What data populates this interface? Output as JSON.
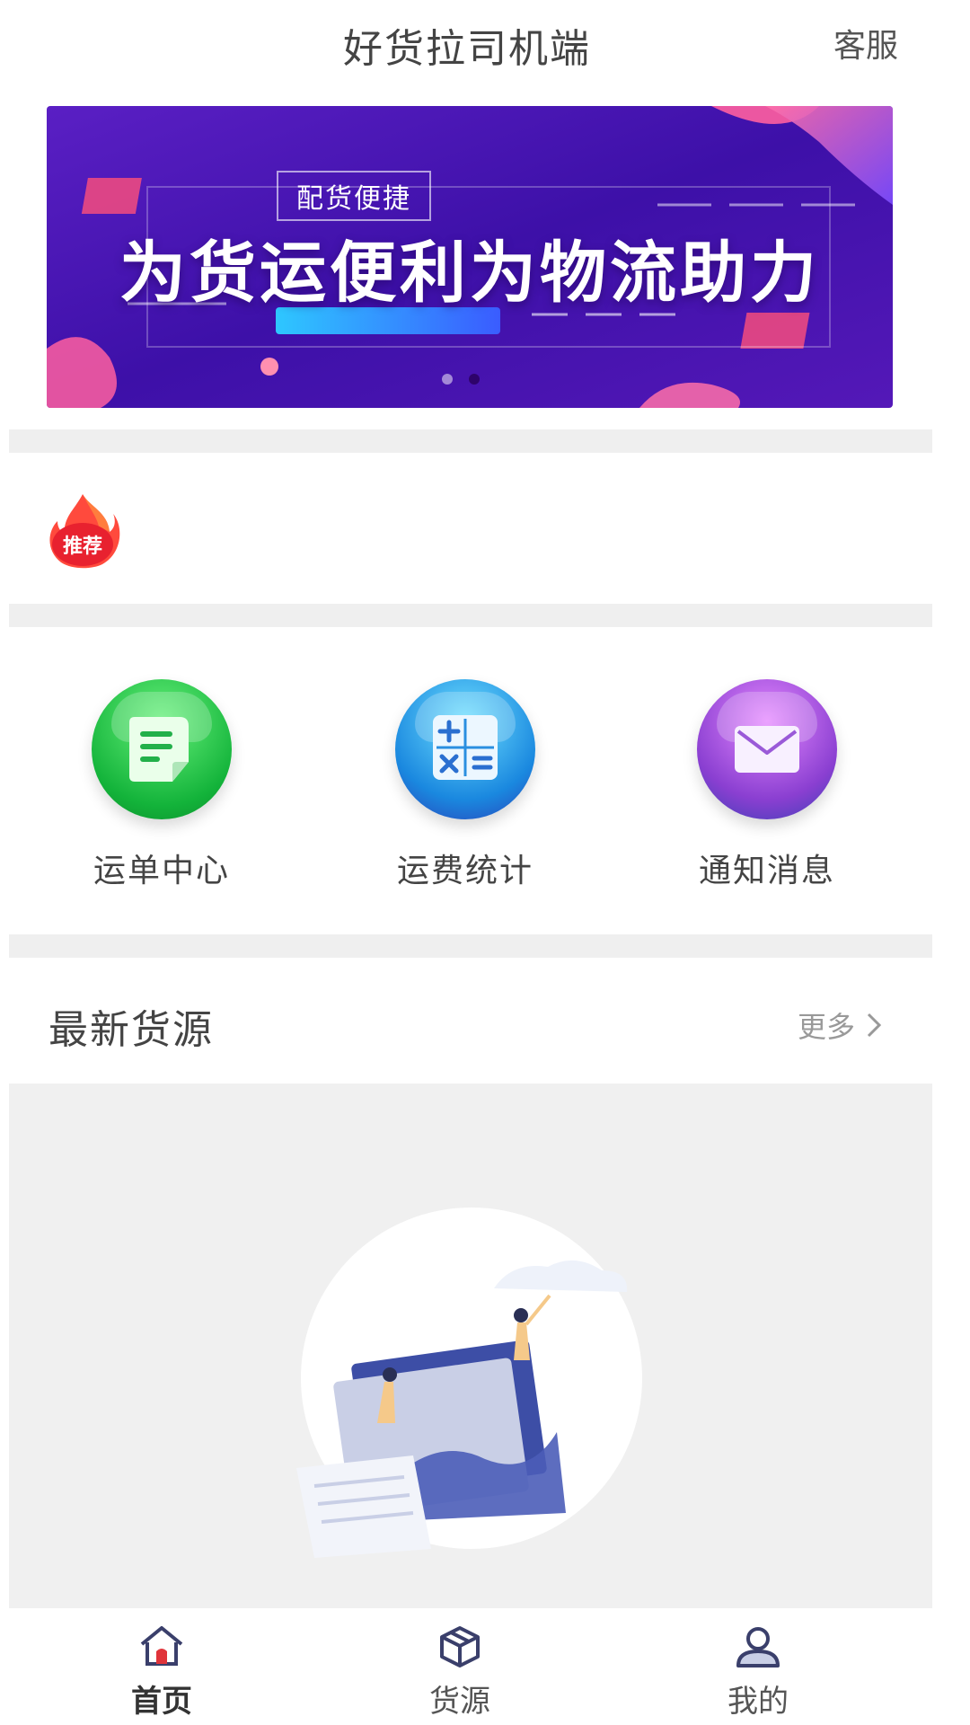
{
  "header": {
    "title": "好货拉司机端",
    "service_label": "客服"
  },
  "banner": {
    "tag": "配货便捷",
    "slogan": "为货运便利为物流助力",
    "slides": 2,
    "active_slide": 2
  },
  "recommend": {
    "label": "推荐"
  },
  "functions": [
    {
      "label": "运单中心",
      "icon": "document-icon",
      "color": "#22c24a"
    },
    {
      "label": "运费统计",
      "icon": "calculator-icon",
      "color": "#1f8fe0"
    },
    {
      "label": "通知消息",
      "icon": "mail-icon",
      "color": "#8a3fd1"
    }
  ],
  "latest": {
    "title": "最新货源",
    "more_label": "更多"
  },
  "tabbar": {
    "items": [
      {
        "label": "首页",
        "icon": "home-icon",
        "active": true
      },
      {
        "label": "货源",
        "icon": "box-icon",
        "active": false
      },
      {
        "label": "我的",
        "icon": "user-icon",
        "active": false
      }
    ]
  },
  "colors": {
    "banner_purple": "#4a12b8",
    "banner_pink": "#ff5fa0",
    "section_gap": "#efefef",
    "empty_bg": "#f0f0f0",
    "illustration_blue": "#3d4ea6"
  }
}
